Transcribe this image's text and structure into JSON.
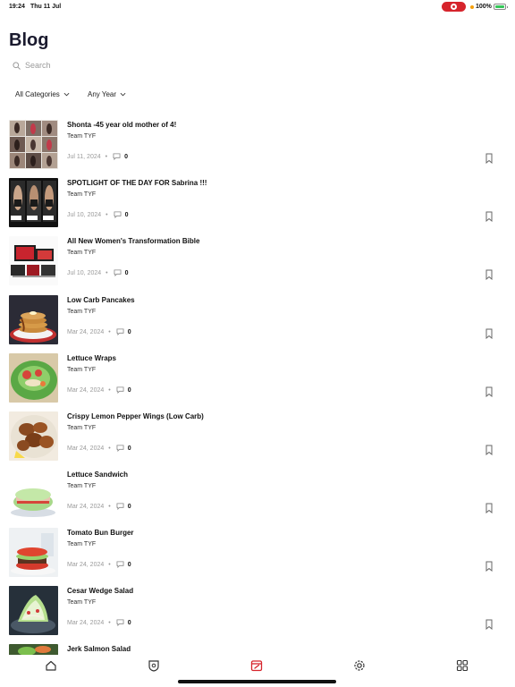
{
  "status_bar": {
    "time": "19:24",
    "date": "Thu 11 Jul",
    "battery": "100%"
  },
  "page": {
    "title": "Blog"
  },
  "search": {
    "placeholder": "Search"
  },
  "filters": {
    "category": "All Categories",
    "year": "Any Year"
  },
  "posts": [
    {
      "title": "Shonta -45 year old mother of 4!",
      "author": "Team TYF",
      "date": "Jul 11, 2024",
      "comments": "0"
    },
    {
      "title": "SPOTLIGHT  OF THE DAY  FOR Sabrina !!!",
      "author": "Team TYF",
      "date": "Jul 10, 2024",
      "comments": "0"
    },
    {
      "title": "All New Women's Transformation Bible",
      "author": "Team TYF",
      "date": "Jul 10, 2024",
      "comments": "0"
    },
    {
      "title": "Low Carb Pancakes",
      "author": "Team TYF",
      "date": "Mar 24, 2024",
      "comments": "0"
    },
    {
      "title": "Lettuce Wraps",
      "author": "Team TYF",
      "date": "Mar 24, 2024",
      "comments": "0"
    },
    {
      "title": "Crispy Lemon Pepper Wings (Low Carb)",
      "author": "Team TYF",
      "date": "Mar 24, 2024",
      "comments": "0"
    },
    {
      "title": "Lettuce Sandwich",
      "author": "Team TYF",
      "date": "Mar 24, 2024",
      "comments": "0"
    },
    {
      "title": "Tomato Bun Burger",
      "author": "Team TYF",
      "date": "Mar 24, 2024",
      "comments": "0"
    },
    {
      "title": "Cesar Wedge Salad",
      "author": "Team TYF",
      "date": "Mar 24, 2024",
      "comments": "0"
    },
    {
      "title": "Jerk Salmon Salad"
    }
  ],
  "colors": {
    "accent": "#d6242c",
    "title": "#1a1a2e",
    "muted": "#9a9a9a",
    "battery": "#35c759"
  },
  "tabs": [
    {
      "icon": "home-icon"
    },
    {
      "icon": "shield-icon"
    },
    {
      "icon": "blog-icon",
      "active": true
    },
    {
      "icon": "gear-icon"
    },
    {
      "icon": "grid-icon"
    }
  ]
}
